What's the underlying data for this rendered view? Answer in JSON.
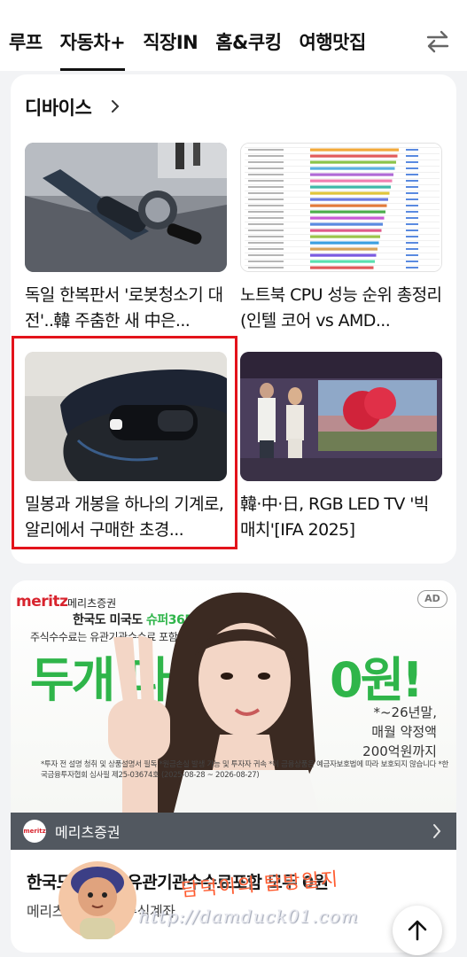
{
  "tabs": [
    {
      "label": "루프",
      "active": false
    },
    {
      "label": "자동차+",
      "active": true
    },
    {
      "label": "직장IN",
      "active": false
    },
    {
      "label": "홈&쿠킹",
      "active": false
    },
    {
      "label": "여행맛집",
      "active": false
    }
  ],
  "tab_switch_icon": "swap-arrows-icon",
  "devices": {
    "title": "디바이스",
    "articles": [
      {
        "title": "독일 한복판서 '로봇청소기 대전'..韓 주춤한 새 中은...",
        "image": "robot-vacuum-photo"
      },
      {
        "title": "노트북 CPU 성능 순위 총정리 (인텔 코어 vs AMD...",
        "image": "cpu-ranking-chart-photo"
      },
      {
        "title": "밀봉과 개봉을 하나의 기계로, 알리에서 구매한 초경...",
        "image": "bag-sealer-photo"
      },
      {
        "title": "韓·中·日, RGB LED TV '빅매치'[IFA 2025]",
        "image": "rgb-led-tv-photo"
      }
    ]
  },
  "ad": {
    "badge": "AD",
    "logo": "meritz",
    "logo_sub": "메리츠증권",
    "line1_prefix": "한국도 미국도 ",
    "line1_highlight": "슈퍼365",
    "line2": "주식수수료는 유관기관수수료 포함",
    "big_left": "두개 다",
    "big_right": "0원!",
    "terms": [
      "*~26년말,",
      "매월 약정액",
      "200억원까지"
    ],
    "fine_print": "*투자 전 설명 청취 및 상품설명서 필독 *원금손실 발생 가능 및 투자자 귀속 *이 금융상품은 예금자보호법에 따라 보호되지 않습니다 *한국금융투자협회 심사필 제25-03674호 (2025-08-28 ~ 2026-08-27)",
    "brand_name": "메리츠증권",
    "headline": "한국도 미국도 유관기관수수료포함 모두 0원",
    "sub": "메리츠 슈퍼365 주식계좌",
    "accent_color": "#2fb54a",
    "brand_color": "#d8242e"
  },
  "watermark": {
    "title": "담덕이의 탐방일지",
    "url": "http://damduck01.com"
  },
  "scroll_top_icon": "arrow-up-icon"
}
